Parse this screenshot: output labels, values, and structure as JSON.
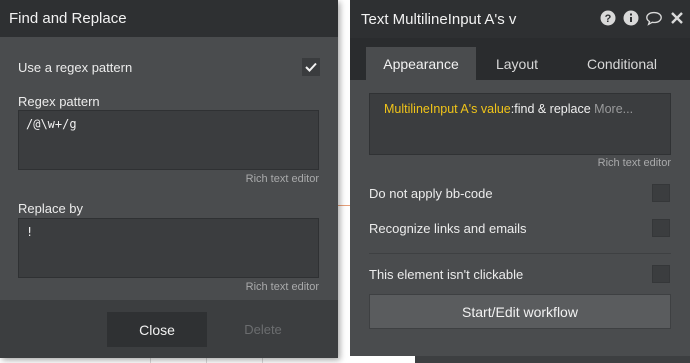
{
  "find_dialog": {
    "title": "Find and Replace",
    "use_regex_label": "Use a regex pattern",
    "use_regex_checked": true,
    "regex_label": "Regex pattern",
    "regex_value": "/@\\w+/g",
    "regex_rte": "Rich text editor",
    "replace_label": "Replace by",
    "replace_value": "!",
    "replace_rte": "Rich text editor",
    "close_label": "Close",
    "delete_label": "Delete"
  },
  "property_editor": {
    "title": "Text MultilineInput A's v",
    "header_icons": [
      "help-icon",
      "info-icon",
      "comment-icon",
      "close-icon"
    ],
    "tabs": [
      {
        "label": "Appearance",
        "active": true
      },
      {
        "label": "Layout",
        "active": false
      },
      {
        "label": "Conditional",
        "active": false
      }
    ],
    "expression": {
      "dynamic": "MultilineInput A's value",
      "operator": ":find & replace",
      "more": " More..."
    },
    "expression_rte": "Rich text editor",
    "options": [
      {
        "label": "Do not apply bb-code",
        "checked": false
      },
      {
        "label": "Recognize links and emails",
        "checked": false
      },
      {
        "label": "This element isn't clickable",
        "checked": false
      }
    ],
    "workflow_button": "Start/Edit workflow"
  },
  "colors": {
    "panel": "#4a4c4e",
    "header": "#2e3032",
    "dynamic_text": "#f0c419"
  }
}
